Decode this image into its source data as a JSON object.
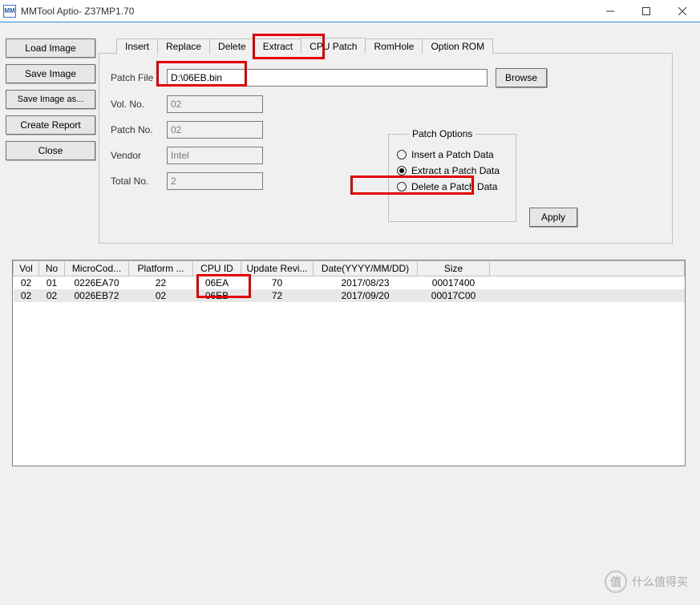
{
  "window": {
    "title": "MMTool Aptio- Z37MP1.70",
    "icon_text": "MM"
  },
  "sidebar": {
    "buttons": [
      {
        "name": "load-image",
        "label": "Load Image"
      },
      {
        "name": "save-image",
        "label": "Save Image"
      },
      {
        "name": "save-image-as",
        "label": "Save Image as..."
      },
      {
        "name": "create-report",
        "label": "Create Report"
      },
      {
        "name": "close",
        "label": "Close"
      }
    ]
  },
  "tabs": [
    {
      "name": "insert",
      "label": "Insert",
      "active": false
    },
    {
      "name": "replace",
      "label": "Replace",
      "active": false
    },
    {
      "name": "delete",
      "label": "Delete",
      "active": false
    },
    {
      "name": "extract",
      "label": "Extract",
      "active": false
    },
    {
      "name": "cpu-patch",
      "label": "CPU Patch",
      "active": true
    },
    {
      "name": "romhole",
      "label": "RomHole",
      "active": false
    },
    {
      "name": "option-rom",
      "label": "Option ROM",
      "active": false
    }
  ],
  "form": {
    "patch_file_label": "Patch File",
    "patch_file_value": "D:\\06EB.bin",
    "browse_label": "Browse",
    "vol_no_label": "Vol. No.",
    "vol_no_value": "02",
    "patch_no_label": "Patch No.",
    "patch_no_value": "02",
    "vendor_label": "Vendor",
    "vendor_value": "Intel",
    "total_no_label": "Total No.",
    "total_no_value": "2"
  },
  "patch_options": {
    "legend": "Patch Options",
    "insert": "Insert a Patch Data",
    "extract": "Extract a Patch Data",
    "delete": "Delete a Patch Data",
    "selected": "extract",
    "apply_label": "Apply"
  },
  "grid": {
    "headers": [
      "Vol",
      "No",
      "MicroCod...",
      "Platform ...",
      "CPU ID",
      "Update Revi...",
      "Date(YYYY/MM/DD)",
      "Size"
    ],
    "rows": [
      {
        "vol": "02",
        "no": "01",
        "microcode": "0226EA70",
        "platform": "22",
        "cpuid": "06EA",
        "rev": "70",
        "date": "2017/08/23",
        "size": "00017400",
        "selected": false
      },
      {
        "vol": "02",
        "no": "02",
        "microcode": "0026EB72",
        "platform": "02",
        "cpuid": "06EB",
        "rev": "72",
        "date": "2017/09/20",
        "size": "00017C00",
        "selected": true
      }
    ]
  },
  "watermark": {
    "text": "什么值得买"
  }
}
